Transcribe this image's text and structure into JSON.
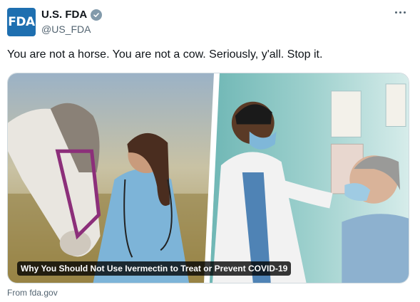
{
  "account": {
    "avatar_text": "FDA",
    "display_name": "U.S. FDA",
    "handle": "@US_FDA",
    "verified": true,
    "avatar_color": "#1e6fb0",
    "verified_badge_color": "#829aab"
  },
  "tweet": {
    "text": "You are not a horse. You are not a cow. Seriously, y'all. Stop it."
  },
  "card": {
    "caption": "Why You Should Not Use Ivermectin to Treat or Prevent COVID-19",
    "source": "From fda.gov",
    "image_left": "horse-with-veterinarian",
    "image_right": "doctor-examining-patient"
  },
  "icons": {
    "more": "more-options-icon",
    "verified": "verified-badge-icon"
  }
}
